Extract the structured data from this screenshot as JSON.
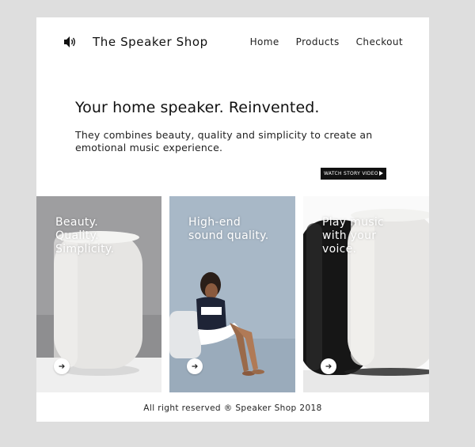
{
  "header": {
    "brand_icon": "speaker-volume-icon",
    "brand_title": "The Speaker Shop",
    "nav": [
      {
        "label": "Home"
      },
      {
        "label": "Products"
      },
      {
        "label": "Checkout"
      }
    ]
  },
  "hero": {
    "title": "Your home speaker. Reinvented.",
    "text": "They combines beauty, quality and simplicity to create an emotional music experience.",
    "video_button_label": "WATCH STORY VIDEO",
    "video_button_icon": "play-triangle-icon"
  },
  "tiles": [
    {
      "lines": [
        "Beauty.",
        "Quality.",
        "Simplicity."
      ],
      "image": "white-speaker-photo",
      "button_icon": "arrow-right-icon"
    },
    {
      "lines": [
        "High-end",
        "sound quality."
      ],
      "image": "woman-sitting-on-speaker-photo",
      "button_icon": "arrow-right-icon"
    },
    {
      "lines": [
        "Play music",
        "with your",
        "voice."
      ],
      "image": "black-and-white-speakers-photo",
      "button_icon": "arrow-right-icon"
    }
  ],
  "footer": {
    "text": "All right reserved ® Speaker Shop 2018"
  },
  "colors": {
    "page_background": "#dedede",
    "card_background": "#ffffff",
    "video_button": "#111111",
    "tile_2_background": "#a3b4c4"
  }
}
